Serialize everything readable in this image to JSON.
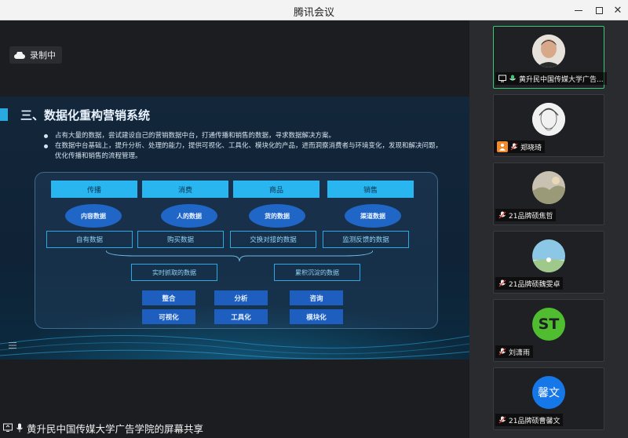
{
  "window": {
    "title": "腾讯会议"
  },
  "share": {
    "recording_label": "录制中",
    "footer_label": "黄升民中国传媒大学广告学院的屏幕共享",
    "slide": {
      "heading": "三、数据化重构营销系统",
      "bullets": [
        "占有大量的数据，尝试建设自己的营销数据中台，打通传播和销售的数据，寻求数据解决方案。",
        "在数据中台基础上，提升分析、处理的能力，提供可视化、工具化、模块化的产品，进而洞察消费者与环境变化，发现和解决问题，优化传播和销售的流程管理。"
      ],
      "headers": [
        "传播",
        "消费",
        "商品",
        "销售"
      ],
      "ovals": [
        "内容数据",
        "人的数据",
        "货的数据",
        "渠道数据"
      ],
      "outlined": [
        "自有数据",
        "购买数据",
        "交换对接的数据",
        "监测反馈的数据"
      ],
      "middle": [
        "实时抓取的数据",
        "累积沉淀的数据"
      ],
      "solid": [
        "整合",
        "分析",
        "咨询",
        "可视化",
        "工具化",
        "模块化"
      ]
    }
  },
  "participants": [
    {
      "name": "黄升民中国传媒大学广告...",
      "avatar": "photo-man",
      "active": true
    },
    {
      "name": "郑晓琦",
      "avatar": "sketch-portrait",
      "active": false
    },
    {
      "name": "21品牌硕焦哲",
      "avatar": "landscape-photo",
      "active": false
    },
    {
      "name": "21品牌硕魏雯卓",
      "avatar": "sky-photo",
      "active": false
    },
    {
      "name": "刘潇雨",
      "avatar": "ST",
      "active": false
    },
    {
      "name": "21品牌硕曹馨文",
      "avatar": "馨文",
      "active": false
    }
  ],
  "colors": {
    "accent_green": "#38c979",
    "slide_cyan": "#29b6f0",
    "avatar_blue": "#1677e8",
    "st_green": "#4fbd2f"
  }
}
